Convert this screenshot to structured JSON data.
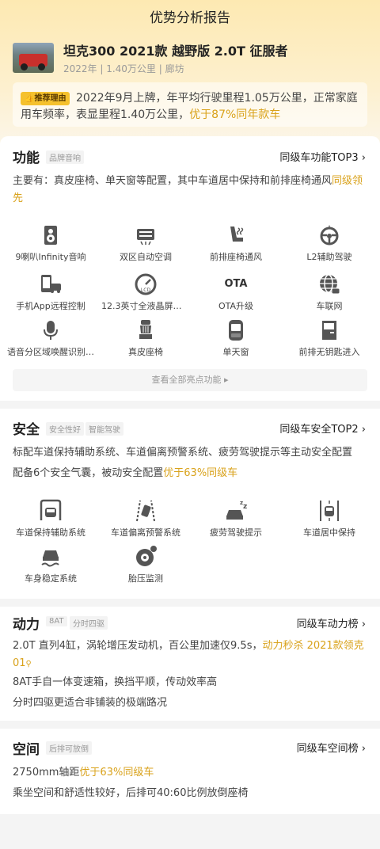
{
  "header": {
    "title": "优势分析报告",
    "car_name": "坦克300 2021款 越野版 2.0T 征服者",
    "car_meta": "2022年 | 1.40万公里 | 廊坊"
  },
  "reason": {
    "tag": "推荐理由",
    "text": "2022年9月上牌，年平均行驶里程1.05万公里，正常家庭用车频率，表显里程1.40万公里，",
    "highlight": "优于87%同年款车"
  },
  "function": {
    "title": "功能",
    "chip": "品牌音响",
    "link": "同级车功能TOP3",
    "desc": "主要有：真皮座椅、单天窗等配置，其中车道居中保持和前排座椅通风",
    "desc_highlight": "同级领先",
    "items": [
      {
        "label": "9喇叭Infinity音响",
        "icon": "speaker-icon"
      },
      {
        "label": "双区自动空调",
        "icon": "ac-icon"
      },
      {
        "label": "前排座椅通风",
        "icon": "seat-vent-icon"
      },
      {
        "label": "L2辅助驾驶",
        "icon": "steering-wheel-icon"
      },
      {
        "label": "手机App远程控制",
        "icon": "phone-car-icon"
      },
      {
        "label": "12.3英寸全液晶屏幕…",
        "icon": "lcd-gauge-icon"
      },
      {
        "label": "OTA升级",
        "icon": "ota-icon"
      },
      {
        "label": "车联网",
        "icon": "globe-icon"
      },
      {
        "label": "语音分区域唤醒识别…",
        "icon": "microphone-icon"
      },
      {
        "label": "真皮座椅",
        "icon": "leather-seat-icon"
      },
      {
        "label": "单天窗",
        "icon": "sunroof-icon"
      },
      {
        "label": "前排无钥匙进入",
        "icon": "door-icon"
      }
    ],
    "more": "查看全部亮点功能"
  },
  "safety": {
    "title": "安全",
    "chips": [
      "安全性好",
      "智能驾驶"
    ],
    "link": "同级车安全TOP2",
    "desc1": "标配车道保持辅助系统、车道偏离预警系统、疲劳驾驶提示等主动安全配置",
    "desc2": "配备6个安全气囊，被动安全配置",
    "desc2_highlight": "优于63%同级车",
    "items": [
      {
        "label": "车道保持辅助系统",
        "icon": "lane-keep-icon"
      },
      {
        "label": "车道偏离预警系统",
        "icon": "lane-departure-icon"
      },
      {
        "label": "疲劳驾驶提示",
        "icon": "fatigue-icon"
      },
      {
        "label": "车道居中保持",
        "icon": "lane-center-icon"
      },
      {
        "label": "车身稳定系统",
        "icon": "stability-icon"
      },
      {
        "label": "胎压监测",
        "icon": "tire-pressure-icon"
      }
    ]
  },
  "power": {
    "title": "动力",
    "chips": [
      "8AT",
      "分时四驱"
    ],
    "link": "同级车动力榜",
    "desc1": "2.0T 直列4缸，涡轮增压发动机，百公里加速仅9.5s，",
    "desc1_highlight": "动力秒杀 2021款领克01",
    "desc2": "8AT手自一体变速箱，换挡平顺，传动效率高",
    "desc3": "分时四驱更适合非铺装的极端路况"
  },
  "space": {
    "title": "空间",
    "chip": "后排可放倒",
    "link": "同级车空间榜",
    "desc1": "2750mm轴距",
    "desc1_highlight": "优于63%同级车",
    "desc2": "乘坐空间和舒适性较好，后排可40:60比例放倒座椅"
  },
  "colors": {
    "accent": "#d9a21b",
    "tag": "#f5c12e",
    "header_bg": "#fde9b2"
  }
}
